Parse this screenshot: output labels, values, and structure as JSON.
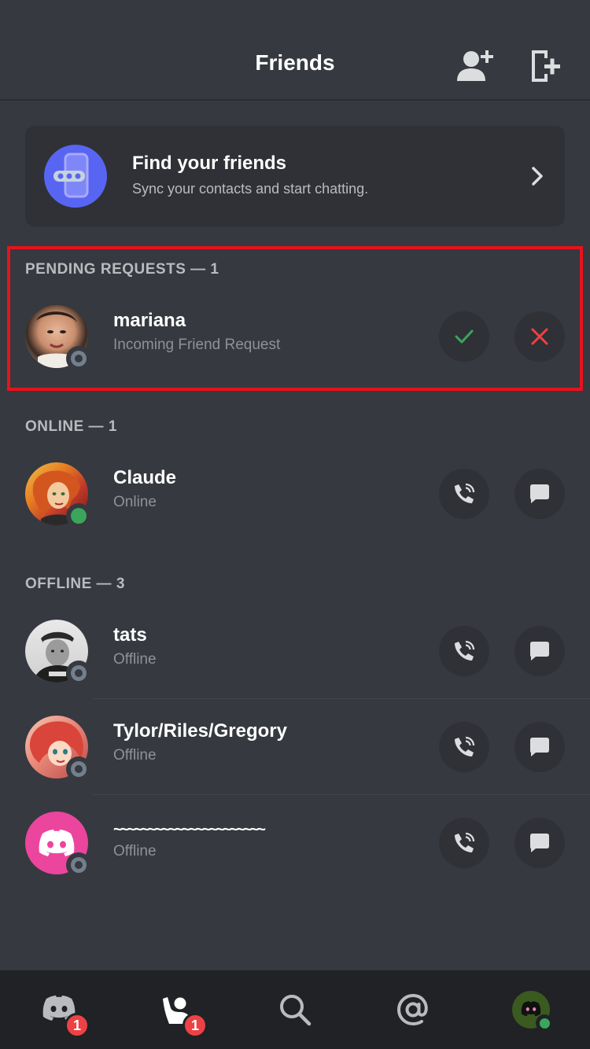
{
  "header": {
    "title": "Friends",
    "add_friend_icon": "add-friend-icon",
    "new_group_dm_icon": "new-group-dm-icon"
  },
  "find_friends": {
    "title": "Find your friends",
    "subtitle": "Sync your contacts and start chatting."
  },
  "sections": {
    "pending": "PENDING REQUESTS — 1",
    "online": "ONLINE — 1",
    "offline": "OFFLINE — 3"
  },
  "pending": [
    {
      "name": "mariana",
      "sub": "Incoming Friend Request",
      "status": "offline"
    }
  ],
  "online": [
    {
      "name": "Claude",
      "sub": "Online",
      "status": "online"
    }
  ],
  "offline": [
    {
      "name": "tats",
      "sub": "Offline",
      "status": "offline"
    },
    {
      "name": "Tylor/Riles/Gregory",
      "sub": "Offline",
      "status": "offline"
    },
    {
      "name": "~~~~~~~~~~~~~~~~~~~~~~",
      "sub": "Offline",
      "status": "offline"
    }
  ],
  "tabbar": {
    "home_badge": "1",
    "friends_badge": "1"
  },
  "colors": {
    "accent": "#5865f2",
    "online": "#3ba55c",
    "danger": "#ed4245",
    "accept": "#3ba55c",
    "highlight_box": "#e8121c"
  }
}
